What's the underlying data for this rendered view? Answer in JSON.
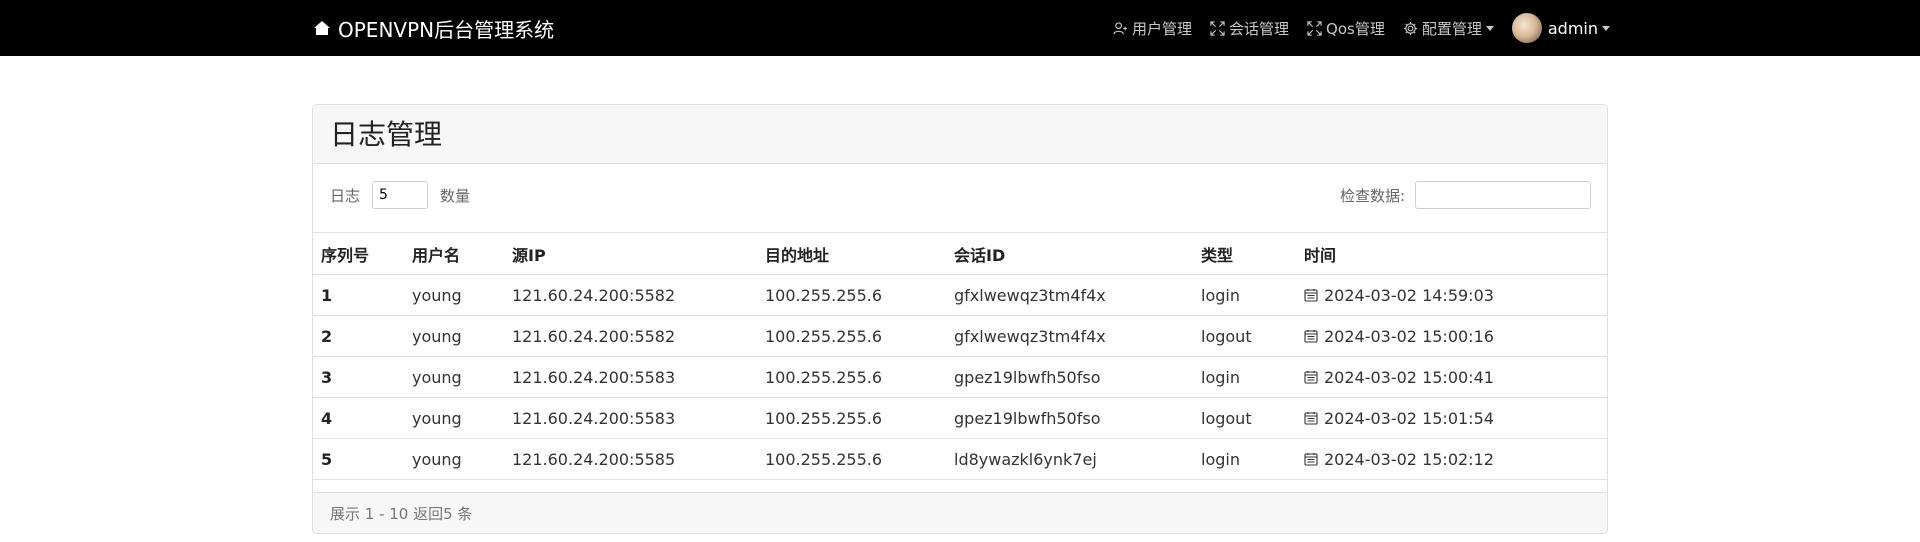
{
  "navbar": {
    "brand": "OPENVPN后台管理系统",
    "items": [
      {
        "label": "用户管理",
        "icon": "user-add-icon"
      },
      {
        "label": "会话管理",
        "icon": "expand-icon"
      },
      {
        "label": "Qos管理",
        "icon": "expand-icon"
      },
      {
        "label": "配置管理",
        "icon": "gear-icon"
      }
    ],
    "user": "admin"
  },
  "card": {
    "title": "日志管理",
    "length_prefix": "日志",
    "length_value": "5",
    "length_suffix": "数量",
    "search_label": "检查数据:",
    "search_value": "",
    "footer": "展示 1 - 10 返回5 条"
  },
  "table": {
    "headers": [
      "序列号",
      "用户名",
      "源IP",
      "目的地址",
      "会话ID",
      "类型",
      "时间"
    ],
    "rows": [
      {
        "id": "1",
        "user": "young",
        "src": "121.60.24.200:5582",
        "dst": "100.255.255.6",
        "session": "gfxlwewqz3tm4f4x",
        "type": "login",
        "time": "2024-03-02 14:59:03"
      },
      {
        "id": "2",
        "user": "young",
        "src": "121.60.24.200:5582",
        "dst": "100.255.255.6",
        "session": "gfxlwewqz3tm4f4x",
        "type": "logout",
        "time": "2024-03-02 15:00:16"
      },
      {
        "id": "3",
        "user": "young",
        "src": "121.60.24.200:5583",
        "dst": "100.255.255.6",
        "session": "gpez19lbwfh50fso",
        "type": "login",
        "time": "2024-03-02 15:00:41"
      },
      {
        "id": "4",
        "user": "young",
        "src": "121.60.24.200:5583",
        "dst": "100.255.255.6",
        "session": "gpez19lbwfh50fso",
        "type": "logout",
        "time": "2024-03-02 15:01:54"
      },
      {
        "id": "5",
        "user": "young",
        "src": "121.60.24.200:5585",
        "dst": "100.255.255.6",
        "session": "ld8ywazkl6ynk7ej",
        "type": "login",
        "time": "2024-03-02 15:02:12"
      }
    ]
  }
}
